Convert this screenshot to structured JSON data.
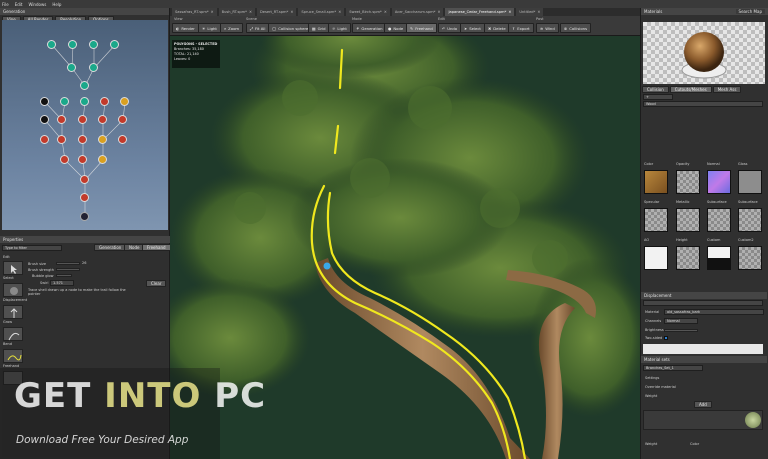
{
  "menubar": {
    "items": [
      "File",
      "Edit",
      "Windows",
      "Help"
    ],
    "right_label": "SpeedTree Modeler"
  },
  "generation": {
    "panel_title": "Generation",
    "buttons": [
      "Vine",
      "All Render",
      "Resolution",
      "Options"
    ]
  },
  "properties": {
    "panel_title": "Properties",
    "filter_placeholder": "Type to filter",
    "mode_buttons": [
      "Generation",
      "Node",
      "Freehand"
    ],
    "tools_label": "Edit",
    "fields": [
      {
        "label": "Brush size",
        "value": "26"
      },
      {
        "label": "Brush strength",
        "value": ""
      },
      {
        "label": "Bubble glow",
        "value": ""
      },
      {
        "label": "Swirl",
        "value": "1.571"
      }
    ],
    "hint": "Trace shell drawn up a node to make the trail follow the pointer",
    "apply_label": "Clear",
    "side_tools": [
      "Select",
      "Displacement",
      "Grow",
      "Bend",
      "Freehand"
    ]
  },
  "tabs": [
    {
      "label": "Sassafras_RT.spm*",
      "active": false
    },
    {
      "label": "Bush_RT.spm*",
      "active": false
    },
    {
      "label": "Desert_RT.spm*",
      "active": false
    },
    {
      "label": "Spruce_Small.spm*",
      "active": false
    },
    {
      "label": "Sweet_Birch.spm*",
      "active": false
    },
    {
      "label": "Acer_Saccharum.spm*",
      "active": false
    },
    {
      "label": "Japanese_Cedar_Freehand.spm*",
      "active": true
    },
    {
      "label": "Untitled*",
      "active": false
    }
  ],
  "toolbar": {
    "groups": [
      {
        "label": "View",
        "buttons": [
          "Render",
          "Light",
          "Zoom"
        ]
      },
      {
        "label": "Scene",
        "buttons": [
          "Fit All",
          "Collision spheres",
          "Grid",
          "Light"
        ]
      },
      {
        "label": "Mode",
        "buttons": [
          "Generation",
          "Node",
          "Freehand"
        ]
      },
      {
        "label": "Edit",
        "buttons": [
          "Undo",
          "Select",
          "Delete",
          "Export"
        ]
      },
      {
        "label": "Post",
        "buttons": [
          "Wind",
          "Collisions"
        ]
      }
    ]
  },
  "stats": {
    "title": "POLYGONS - SELECTED",
    "lines": [
      "Branches: 35,180",
      "TOTAL: 21,140",
      "Leaves: 0"
    ]
  },
  "materials": {
    "panel_title": "Materials",
    "search_placeholder": "Search Map",
    "tabs": [
      "Collision",
      "Cutouts/Meshes",
      "Mesh Ass"
    ],
    "name_label": "Wood",
    "slot_labels": [
      "Color",
      "Opacity",
      "Normal",
      "Gloss",
      "Specular",
      "Metallic",
      "Subsurface",
      "Subsurface",
      "AO",
      "Height",
      "Custom",
      "Custom2"
    ],
    "section2_title": "Displacement",
    "section2_fields": [
      {
        "label": "Material",
        "value": "old_sassafras_bark"
      },
      {
        "label": "Channels",
        "value": "Normal"
      },
      {
        "label": "Brightness",
        "value": ""
      },
      {
        "label": "Two-sided",
        "value": ""
      }
    ],
    "section3_title": "Material sets",
    "section3_item": "Branches_Set_1",
    "section3_fields": [
      {
        "label": "Settings",
        "value": ""
      },
      {
        "label": "Override material",
        "value": ""
      },
      {
        "label": "Weight",
        "value": ""
      }
    ],
    "add_label": "Add",
    "footer": [
      "Weight",
      "Color"
    ]
  },
  "watermark": {
    "line1_a": "GET ",
    "line1_b": "INTO",
    "line1_c": " PC",
    "line2": "Download Free Your Desired App"
  },
  "colors": {
    "accent_yellow": "#f0e81e",
    "viewport_bg": "#1f3a2a",
    "bark": "#9a7650"
  }
}
